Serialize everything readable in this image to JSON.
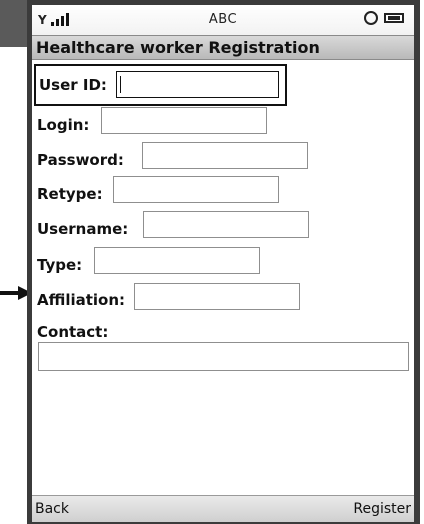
{
  "status_bar": {
    "carrier": "ABC"
  },
  "title": "Healthcare worker Registration",
  "form": {
    "user_id_label": "User ID:",
    "login_label": "Login:",
    "password_label": "Password:",
    "retype_label": "Retype:",
    "username_label": "Username:",
    "type_label": "Type:",
    "affiliation_label": "Affiliation:",
    "contact_label": "Contact:",
    "user_id_value": "",
    "login_value": "",
    "password_value": "",
    "retype_value": "",
    "username_value": "",
    "type_value": "",
    "affiliation_value": "",
    "contact_value": ""
  },
  "softkeys": {
    "left": "Back",
    "right": "Register"
  },
  "icons": {
    "signal": "signal-icon",
    "settings": "gear-icon",
    "battery": "battery-icon",
    "pointer": "arrow-right-icon"
  }
}
